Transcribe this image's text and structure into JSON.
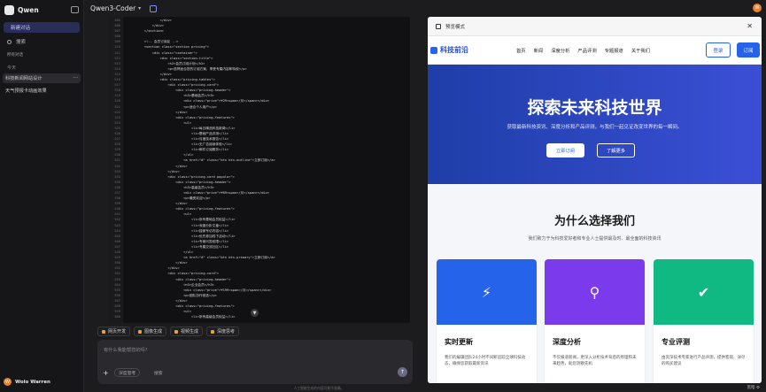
{
  "sidebar": {
    "brand": "Qwen",
    "new_chat": "新建对话",
    "search": "搜索",
    "folder": "所有对话",
    "section_today": "今天",
    "items": [
      {
        "label": "科技新闻网站设计",
        "active": true,
        "menu": "···"
      },
      {
        "label": "天气预报卡动画效果",
        "active": false,
        "menu": ""
      }
    ],
    "user": {
      "initial": "W",
      "name": "Wolo Warren"
    }
  },
  "header": {
    "model": "Qwen3-Coder",
    "avatar_initial": "W"
  },
  "code": {
    "lines": [
      {
        "n": "505",
        "t": "                </div>"
      },
      {
        "n": "506",
        "t": "            </div>"
      },
      {
        "n": "507",
        "t": "        </section>"
      },
      {
        "n": "508",
        "t": ""
      },
      {
        "n": "509",
        "t": "        <!-- 会员订阅区 -->"
      },
      {
        "n": "510",
        "t": "        <section class=\"section pricing\">"
      },
      {
        "n": "511",
        "t": "            <div class=\"container\">"
      },
      {
        "n": "512",
        "t": "                <div class=\"section-title\">"
      },
      {
        "n": "513",
        "t": "                    <h2>会员订阅计划</h2>"
      },
      {
        "n": "514",
        "t": "                    <p>选择适合您的订阅方案，享受专属内容和特权</p>"
      },
      {
        "n": "515",
        "t": "                </div>"
      },
      {
        "n": "516",
        "t": "                <div class=\"pricing-tables\">"
      },
      {
        "n": "517",
        "t": "                    <div class=\"pricing-card\">"
      },
      {
        "n": "518",
        "t": "                        <div class=\"pricing-header\">"
      },
      {
        "n": "519",
        "t": "                            <h3>基础会员</h3>"
      },
      {
        "n": "520",
        "t": "                            <div class=\"price\">¥29<span>/月</span></div>"
      },
      {
        "n": "521",
        "t": "                            <p>适合个人用户</p>"
      },
      {
        "n": "522",
        "t": "                        </div>"
      },
      {
        "n": "523",
        "t": "                        <div class=\"pricing-features\">"
      },
      {
        "n": "524",
        "t": "                            <ul>"
      },
      {
        "n": "525",
        "t": "                                <li>每日精选科技新闻</li>"
      },
      {
        "n": "526",
        "t": "                                <li>基础产品评测</li>"
      },
      {
        "n": "527",
        "t": "                                <li>月度技术报告</li>"
      },
      {
        "n": "528",
        "t": "                                <li>无广告阅读体验</li>"
      },
      {
        "n": "529",
        "t": "                                <li>邮件订阅服务</li>"
      },
      {
        "n": "530",
        "t": "                            </ul>"
      },
      {
        "n": "531",
        "t": "                            <a href=\"#\" class=\"btn btn-outline\">立即订阅</a>"
      },
      {
        "n": "532",
        "t": "                        </div>"
      },
      {
        "n": "533",
        "t": "                    </div>"
      },
      {
        "n": "534",
        "t": "                    <div class=\"pricing-card popular\">"
      },
      {
        "n": "535",
        "t": "                        <div class=\"pricing-header\">"
      },
      {
        "n": "536",
        "t": "                            <h3>高级会员</h3>"
      },
      {
        "n": "537",
        "t": "                            <div class=\"price\">¥69<span>/月</span></div>"
      },
      {
        "n": "538",
        "t": "                            <p>最受欢迎</p>"
      },
      {
        "n": "539",
        "t": "                        </div>"
      },
      {
        "n": "540",
        "t": "                        <div class=\"pricing-features\">"
      },
      {
        "n": "541",
        "t": "                            <ul>"
      },
      {
        "n": "542",
        "t": "                                <li>所有基础会员权益</li>"
      },
      {
        "n": "543",
        "t": "                                <li>深度分析文章</li>"
      },
      {
        "n": "544",
        "t": "                                <li>独家专访内容</li>"
      },
      {
        "n": "545",
        "t": "                                <li>优先参加线下活动</li>"
      },
      {
        "n": "546",
        "t": "                                <li>专家问答权限</li>"
      },
      {
        "n": "547",
        "t": "                                <li>专属交流社区</li>"
      },
      {
        "n": "548",
        "t": "                            </ul>"
      },
      {
        "n": "549",
        "t": "                            <a href=\"#\" class=\"btn btn-primary\">立即订阅</a>"
      },
      {
        "n": "550",
        "t": "                        </div>"
      },
      {
        "n": "551",
        "t": "                    </div>"
      },
      {
        "n": "552",
        "t": "                    <div class=\"pricing-card\">"
      },
      {
        "n": "553",
        "t": "                        <div class=\"pricing-header\">"
      },
      {
        "n": "554",
        "t": "                            <h3>企业会员</h3>"
      },
      {
        "n": "555",
        "t": "                            <div class=\"price\">¥199<span>/月</span></div>"
      },
      {
        "n": "556",
        "t": "                            <p>团队协作首选</p>"
      },
      {
        "n": "557",
        "t": "                        </div>"
      },
      {
        "n": "558",
        "t": "                        <div class=\"pricing-features\">"
      },
      {
        "n": "559",
        "t": "                            <ul>"
      },
      {
        "n": "560",
        "t": "                                <li>所有高级会员权益</li>"
      }
    ]
  },
  "tools": [
    "网页开发",
    "图像生成",
    "视频生成",
    "深度思考"
  ],
  "input": {
    "placeholder": "有什么我能帮您的吗?",
    "think_pill": "深度思考",
    "search_pill": "搜索"
  },
  "disclaimer": "人工智能生成的内容可能不准确。",
  "preview": {
    "title": "预览模式",
    "site": {
      "logo": "科技前沿",
      "nav": [
        "首页",
        "新闻",
        "深度分析",
        "产品评测",
        "专题报道",
        "关于我们"
      ],
      "login": "登录",
      "subscribe": "订阅",
      "hero_title": "探索未来科技世界",
      "hero_sub": "获取最新科技资讯、深度分析和产品评测，与我们一起见证改变世界的每一瞬间。",
      "hero_btn1": "立即订阅",
      "hero_btn2": "了解更多",
      "why_title": "为什么选择我们",
      "why_sub": "我们致力于为科技爱好者和专业人士提供最及时、最全面的科技资讯",
      "cards": [
        {
          "title": "实时更新",
          "text": "我们的编辑团队24小时不间断追踪全球科技动态，确保您获取最新资讯",
          "color": "#2563eb",
          "icon": "bolt-icon"
        },
        {
          "title": "深度分析",
          "text": "不仅报道新闻，更深入分析技术背后的原理和未来趋势，助您洞察先机",
          "color": "#7c3aed",
          "icon": "magnifier-icon"
        },
        {
          "title": "专业评测",
          "text": "由资深技术专家进行产品评测，提供客观、详尽的购买建议",
          "color": "#10b981",
          "icon": "user-check-icon"
        }
      ]
    },
    "status": "黑暗 ⚙"
  }
}
